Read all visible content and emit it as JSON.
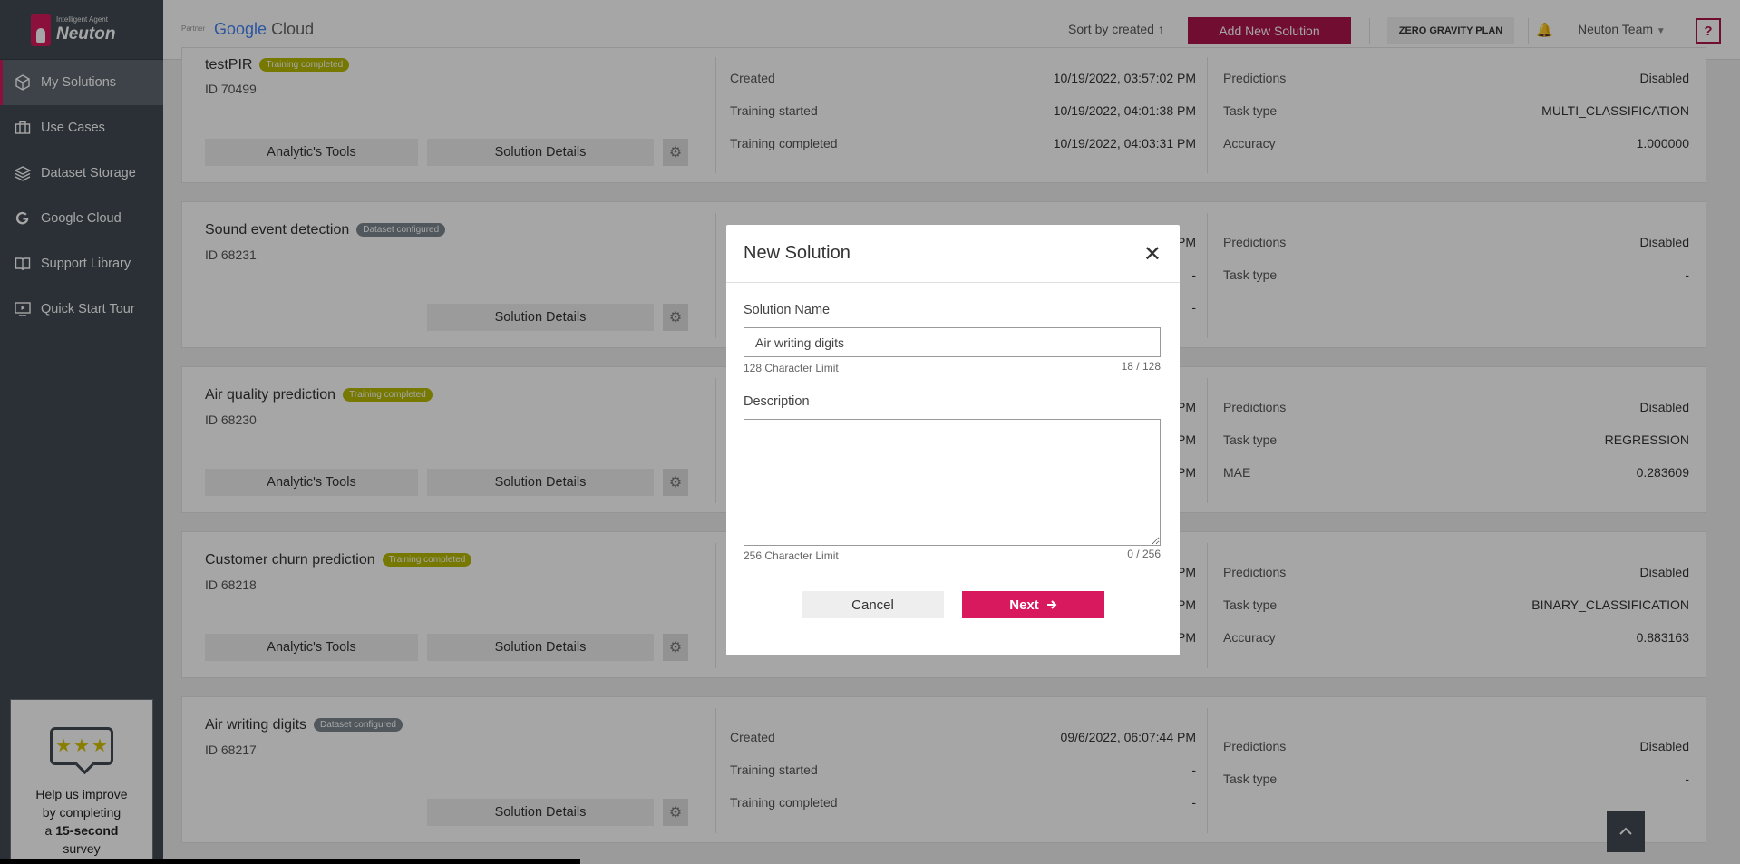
{
  "brand": {
    "small": "Intelligent Agent",
    "name": "Neuton",
    "color": "#d8195d"
  },
  "sidebar": {
    "items": [
      {
        "label": "My Solutions",
        "icon": "cube-icon"
      },
      {
        "label": "Use Cases",
        "icon": "briefcase-icon"
      },
      {
        "label": "Dataset Storage",
        "icon": "layers-icon"
      },
      {
        "label": "Google Cloud",
        "icon": "google-g-icon"
      },
      {
        "label": "Support Library",
        "icon": "book-icon"
      },
      {
        "label": "Quick Start Tour",
        "icon": "play-screen-icon"
      }
    ],
    "survey": {
      "line1": "Help us improve",
      "line2": "by completing",
      "line3_pre": "a ",
      "line3_bold": "15-second",
      "line4": "survey"
    }
  },
  "header": {
    "partner": "Partner",
    "cloud_google": "Google",
    "cloud_word": "Cloud",
    "sort": "Sort by created ↑",
    "add_button": "Add New Solution",
    "plan": "ZERO GRAVITY PLAN",
    "team": "Neuton Team",
    "help": "?"
  },
  "cards": [
    {
      "name": "testPIR",
      "badge": "Training completed",
      "id": "ID 70499",
      "tools": "Analytic's Tools",
      "details": "Solution Details",
      "mid": [
        {
          "label": "Created",
          "value": "10/19/2022, 03:57:02 PM"
        },
        {
          "label": "Training started",
          "value": "10/19/2022, 04:01:38 PM"
        },
        {
          "label": "Training completed",
          "value": "10/19/2022, 04:03:31 PM"
        }
      ],
      "right": [
        {
          "label": "Predictions",
          "value": "Disabled"
        },
        {
          "label": "Task type",
          "value": "MULTI_CLASSIFICATION"
        },
        {
          "label": "Accuracy",
          "value": "1.000000"
        }
      ]
    },
    {
      "name": "Sound event detection",
      "badge": "Dataset configured",
      "id": "ID 68231",
      "details": "Solution Details",
      "mid": [
        {
          "value": "PM"
        },
        {
          "value": "-"
        },
        {
          "value": "-"
        }
      ],
      "right": [
        {
          "label": "Predictions",
          "value": "Disabled"
        },
        {
          "label": "Task type",
          "value": "-"
        }
      ]
    },
    {
      "name": "Air quality prediction",
      "badge": "Training completed",
      "id": "ID 68230",
      "tools": "Analytic's Tools",
      "details": "Solution Details",
      "mid": [
        {
          "value": "PM"
        },
        {
          "value": "PM"
        },
        {
          "value": "PM"
        }
      ],
      "right": [
        {
          "label": "Predictions",
          "value": "Disabled"
        },
        {
          "label": "Task type",
          "value": "REGRESSION"
        },
        {
          "label": "MAE",
          "value": "0.283609"
        }
      ]
    },
    {
      "name": "Customer churn prediction",
      "badge": "Training completed",
      "id": "ID 68218",
      "tools": "Analytic's Tools",
      "details": "Solution Details",
      "mid": [
        {
          "value": "PM"
        },
        {
          "value": "PM"
        },
        {
          "value": "PM"
        }
      ],
      "right": [
        {
          "label": "Predictions",
          "value": "Disabled"
        },
        {
          "label": "Task type",
          "value": "BINARY_CLASSIFICATION"
        },
        {
          "label": "Accuracy",
          "value": "0.883163"
        }
      ]
    },
    {
      "name": "Air writing digits",
      "badge": "Dataset configured",
      "id": "ID 68217",
      "details": "Solution Details",
      "mid": [
        {
          "label": "Created",
          "value": "09/6/2022, 06:07:44 PM"
        },
        {
          "label": "Training started",
          "value": "-"
        },
        {
          "label": "Training completed",
          "value": "-"
        }
      ],
      "right": [
        {
          "label": "Predictions",
          "value": "Disabled"
        },
        {
          "label": "Task type",
          "value": "-"
        }
      ]
    }
  ],
  "modal": {
    "title": "New Solution",
    "close": "✕",
    "name_label": "Solution Name",
    "name_value": "Air writing digits",
    "name_limit": "128 Character Limit",
    "name_count": "18 / 128",
    "desc_label": "Description",
    "desc_value": "",
    "desc_limit": "256 Character Limit",
    "desc_count": "0 / 256",
    "cancel": "Cancel",
    "next": "Next"
  }
}
